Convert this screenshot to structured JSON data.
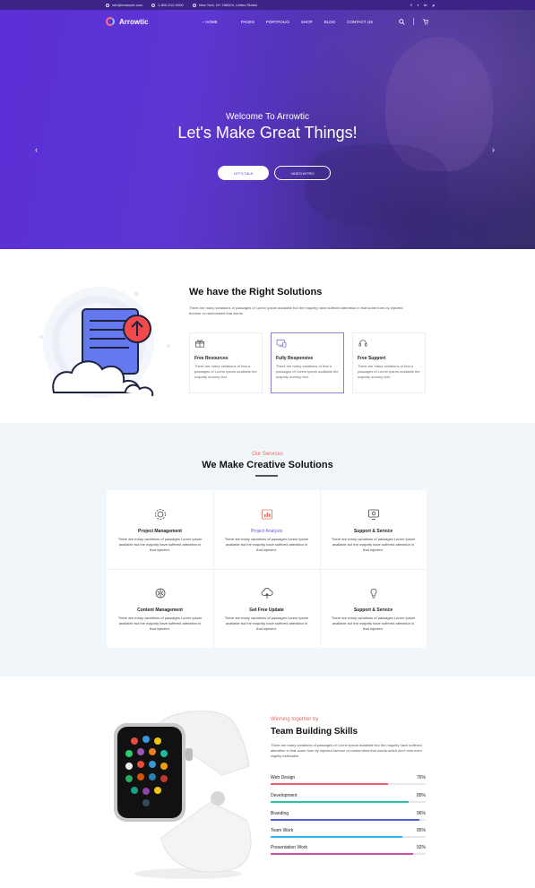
{
  "topbar": {
    "email": "info@example.com",
    "phone": "1-800-012-0000",
    "address": "New York, NY 256304, United States",
    "social": [
      "f",
      "t",
      "in",
      "p"
    ]
  },
  "nav": {
    "logo": "Arrowtic",
    "menu": [
      "HOME",
      "PAGES",
      "PORTFOLIO",
      "SHOP",
      "BLOG",
      "CONTACT US"
    ],
    "icons": [
      "search-icon",
      "cart-icon"
    ]
  },
  "hero": {
    "subtitle": "Welcome To Arrowtic",
    "title": "Let's Make Great Things!",
    "btn_primary": "LET'S TALK",
    "btn_secondary": "VIDEO INTRO",
    "prev": "‹",
    "next": "›"
  },
  "solutions": {
    "title": "We have the Right Solutions",
    "text": "There are many variations of passages of Lorem Ipsum available but the majority have suffered alteration in that  some form by injected humour or randomised that words.",
    "features": [
      {
        "title": "Free Resources",
        "text": "There are many variations of that a passages of Lorem Ipsum available the majority dummy text.",
        "icon": "gift-icon"
      },
      {
        "title": "Fully Responsive",
        "text": "There are many variations of that a passages of Lorem Ipsum available the majority dummy text.",
        "icon": "devices-icon"
      },
      {
        "title": "Free Support",
        "text": "There are many variations of that a passages of Lorem Ipsum available the majority dummy text.",
        "icon": "headset-icon"
      }
    ]
  },
  "services": {
    "subtitle": "Our Services",
    "title": "We Make Creative Solutions",
    "items": [
      {
        "title": "Project Management",
        "text": "There are many variations of passages Lorem Ipsum available but the majority have suffered alteration in that injected.",
        "icon": "gear-icon"
      },
      {
        "title": "Project Analysis",
        "text": "There are many variations of passages Lorem Ipsum available but the majority have suffered alteration in that injected.",
        "icon": "chart-icon"
      },
      {
        "title": "Support & Service",
        "text": "There are many variations of passages Lorem Ipsum available but the majority have suffered alteration in that injected.",
        "icon": "monitor-icon"
      },
      {
        "title": "Content Management",
        "text": "There are many variations of passages Lorem Ipsum available but the majority have suffered alteration in that injected.",
        "icon": "brain-icon"
      },
      {
        "title": "Get Free Update",
        "text": "There are many variations of passages Lorem Ipsum available but the majority have suffered alteration in that injected.",
        "icon": "cloud-icon"
      },
      {
        "title": "Support & Service",
        "text": "There are many variations of passages Lorem Ipsum available but the majority have suffered alteration in that injected.",
        "icon": "bulb-icon"
      }
    ]
  },
  "skills": {
    "subtitle": "Winning together by",
    "title": "Team Building Skills",
    "text": "There are many variations of passages of Lorem Ipsum available but the majority have suffered alteration in that  some form by injected humour or randomised that words which don't look even slightly believable.",
    "items": [
      {
        "label": "Web Design",
        "value": "76%",
        "percent": 76,
        "color": "#f25b6b"
      },
      {
        "label": "Development",
        "value": "89%",
        "percent": 89,
        "color": "#26c7a7"
      },
      {
        "label": "Branding",
        "value": "96%",
        "percent": 96,
        "color": "#4a63d8"
      },
      {
        "label": "Team Work",
        "value": "85%",
        "percent": 85,
        "color": "#2bb8e6"
      },
      {
        "label": "Presentation Work",
        "value": "92%",
        "percent": 92,
        "color": "#d04ea6"
      }
    ]
  }
}
